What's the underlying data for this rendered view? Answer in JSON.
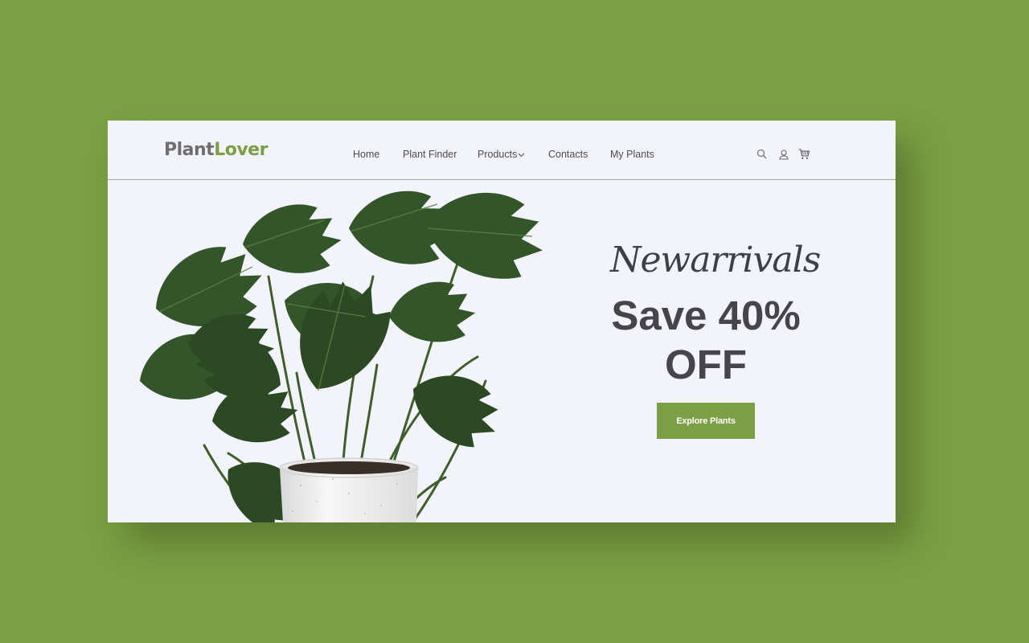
{
  "brand": {
    "name_part1": "Plant",
    "name_part2": "Lover",
    "color_gray": "#6f6f6f",
    "color_green": "#7ba043"
  },
  "nav": {
    "items": [
      {
        "label": "Home"
      },
      {
        "label": "Plant Finder"
      },
      {
        "label": "Products",
        "has_dropdown": true
      },
      {
        "label": "Contacts"
      },
      {
        "label": "My Plants"
      }
    ]
  },
  "header_icons": [
    "search-icon",
    "user-icon",
    "cart-icon"
  ],
  "hero": {
    "script_title": "Newarrivals",
    "headline_line1": "Save 40%",
    "headline_line2": "OFF",
    "cta_label": "Explore Plants",
    "image": "monstera-plant-in-white-pot"
  },
  "colors": {
    "page_background": "#7ba043",
    "card_background": "#f2f3fb",
    "accent": "#7ba043",
    "text_dark": "#45454b"
  }
}
